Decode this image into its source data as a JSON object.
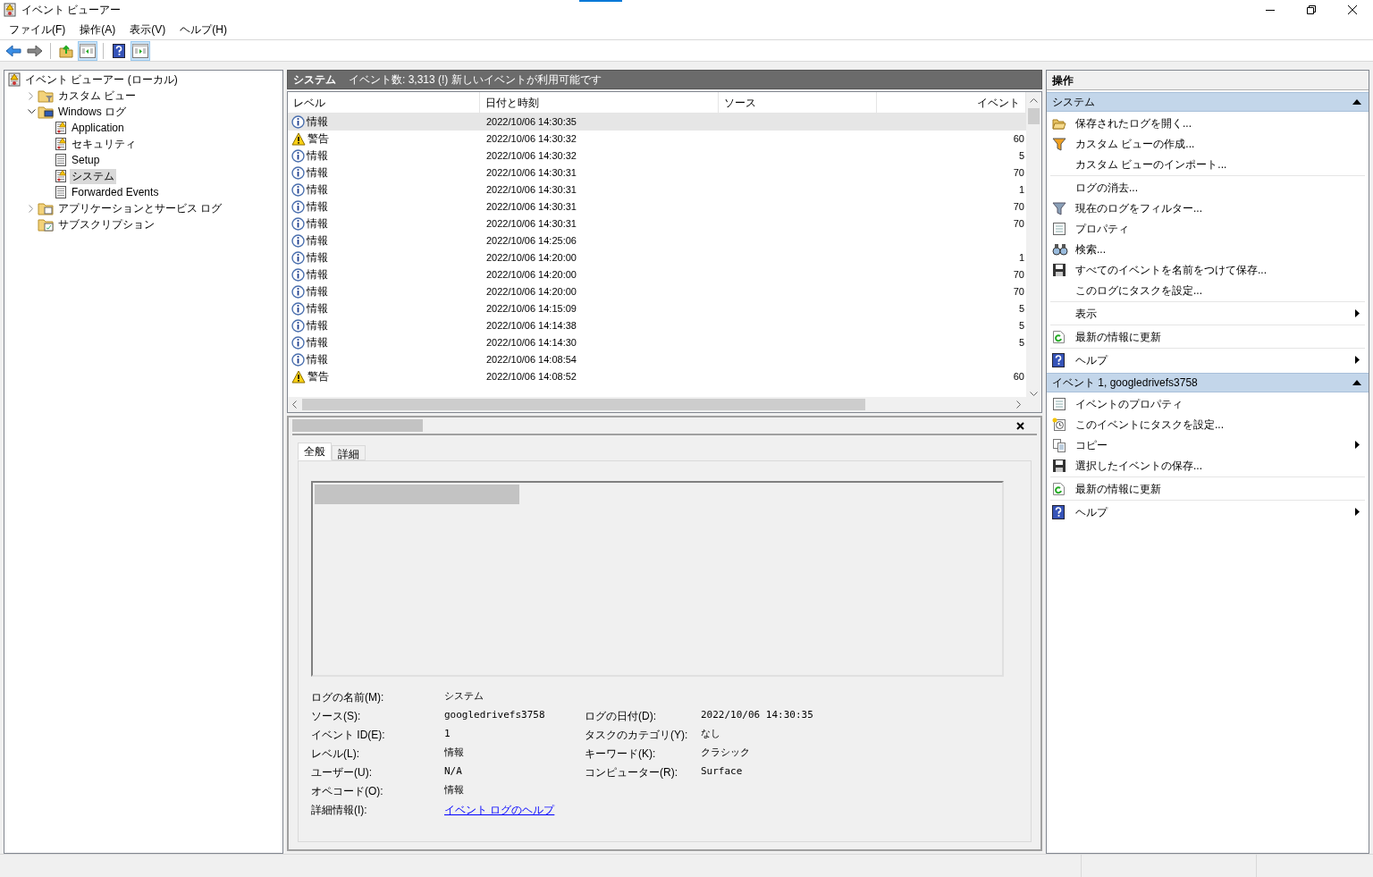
{
  "window": {
    "title": "イベント ビューアー"
  },
  "menu": [
    "ファイル(F)",
    "操作(A)",
    "表示(V)",
    "ヘルプ(H)"
  ],
  "toolbar": [
    {
      "kind": "back",
      "selected": false
    },
    {
      "kind": "forward",
      "selected": false
    },
    {
      "kind": "sep"
    },
    {
      "kind": "up",
      "selected": false
    },
    {
      "kind": "pane-left",
      "selected": true
    },
    {
      "kind": "sep"
    },
    {
      "kind": "help",
      "selected": false
    },
    {
      "kind": "pane-right",
      "selected": true
    }
  ],
  "tree": [
    {
      "label": "イベント ビューアー (ローカル)",
      "kind": "viewer",
      "selected": false,
      "children": [
        {
          "label": "カスタム ビュー",
          "kind": "filter-folder",
          "expanded": false,
          "selected": false
        },
        {
          "label": "Windows ログ",
          "kind": "pc-folder",
          "expanded": true,
          "selected": false,
          "children": [
            {
              "label": "Application",
              "kind": "log-warn",
              "selected": false
            },
            {
              "label": "セキュリティ",
              "kind": "log-warn",
              "selected": false
            },
            {
              "label": "Setup",
              "kind": "log",
              "selected": false
            },
            {
              "label": "システム",
              "kind": "log-warn",
              "selected": true
            },
            {
              "label": "Forwarded Events",
              "kind": "log",
              "selected": false
            }
          ]
        },
        {
          "label": "アプリケーションとサービス ログ",
          "kind": "folder",
          "expanded": false,
          "selected": false
        },
        {
          "label": "サブスクリプション",
          "kind": "sub-folder",
          "selected": false
        }
      ]
    }
  ],
  "log_header": {
    "name": "システム",
    "info": "イベント数: 3,313 (!) 新しいイベントが利用可能です"
  },
  "table": {
    "columns": [
      "レベル",
      "日付と時刻",
      "ソース",
      "イベント"
    ],
    "rows": [
      {
        "kind": "info",
        "level": "情報",
        "date": "2022/10/06 14:30:35",
        "event": "",
        "selected": true
      },
      {
        "kind": "warning",
        "level": "警告",
        "date": "2022/10/06 14:30:32",
        "event": "60",
        "selected": false
      },
      {
        "kind": "info",
        "level": "情報",
        "date": "2022/10/06 14:30:32",
        "event": "5",
        "selected": false
      },
      {
        "kind": "info",
        "level": "情報",
        "date": "2022/10/06 14:30:31",
        "event": "70",
        "selected": false
      },
      {
        "kind": "info",
        "level": "情報",
        "date": "2022/10/06 14:30:31",
        "event": "1",
        "selected": false
      },
      {
        "kind": "info",
        "level": "情報",
        "date": "2022/10/06 14:30:31",
        "event": "70",
        "selected": false
      },
      {
        "kind": "info",
        "level": "情報",
        "date": "2022/10/06 14:30:31",
        "event": "70",
        "selected": false
      },
      {
        "kind": "info",
        "level": "情報",
        "date": "2022/10/06 14:25:06",
        "event": "",
        "selected": false
      },
      {
        "kind": "info",
        "level": "情報",
        "date": "2022/10/06 14:20:00",
        "event": "1",
        "selected": false
      },
      {
        "kind": "info",
        "level": "情報",
        "date": "2022/10/06 14:20:00",
        "event": "70",
        "selected": false
      },
      {
        "kind": "info",
        "level": "情報",
        "date": "2022/10/06 14:20:00",
        "event": "70",
        "selected": false
      },
      {
        "kind": "info",
        "level": "情報",
        "date": "2022/10/06 14:15:09",
        "event": "5",
        "selected": false
      },
      {
        "kind": "info",
        "level": "情報",
        "date": "2022/10/06 14:14:38",
        "event": "5",
        "selected": false
      },
      {
        "kind": "info",
        "level": "情報",
        "date": "2022/10/06 14:14:30",
        "event": "5",
        "selected": false
      },
      {
        "kind": "info",
        "level": "情報",
        "date": "2022/10/06 14:08:54",
        "event": "",
        "selected": false
      },
      {
        "kind": "warning",
        "level": "警告",
        "date": "2022/10/06 14:08:52",
        "event": "60",
        "selected": false
      }
    ]
  },
  "detail": {
    "tabs": [
      {
        "label": "全般",
        "selected": true
      },
      {
        "label": "詳細",
        "selected": false
      }
    ],
    "fields_left": [
      {
        "label": "ログの名前(M):",
        "value": "システム"
      },
      {
        "label": "ソース(S):",
        "value": "googledrivefs3758"
      },
      {
        "label": "イベント ID(E):",
        "value": "1"
      },
      {
        "label": "レベル(L):",
        "value": "情報"
      },
      {
        "label": "ユーザー(U):",
        "value": "N/A"
      },
      {
        "label": "オペコード(O):",
        "value": "情報"
      },
      {
        "label": "詳細情報(I):",
        "value": "イベント ログのヘルプ",
        "kind": "link"
      }
    ],
    "fields_right": [
      {
        "label": "ログの日付(D):",
        "value": "2022/10/06 14:30:35"
      },
      {
        "label": "タスクのカテゴリ(Y):",
        "value": "なし"
      },
      {
        "label": "キーワード(K):",
        "value": "クラシック"
      },
      {
        "label": "コンピューター(R):",
        "value": "Surface"
      }
    ]
  },
  "actions": {
    "title": "操作",
    "sections": [
      {
        "title": "システム",
        "expanded": true,
        "groups": [
          [
            {
              "label": "保存されたログを開く...",
              "kind": "open",
              "submenu": false
            },
            {
              "label": "カスタム ビューの作成...",
              "kind": "filter-color",
              "submenu": false
            },
            {
              "label": "カスタム ビューのインポート...",
              "kind": "none",
              "submenu": false
            }
          ],
          [
            {
              "label": "ログの消去...",
              "kind": "none",
              "submenu": false
            },
            {
              "label": "現在のログをフィルター...",
              "kind": "filter",
              "submenu": false
            },
            {
              "label": "プロパティ",
              "kind": "properties",
              "submenu": false
            },
            {
              "label": "検索...",
              "kind": "find",
              "submenu": false
            },
            {
              "label": "すべてのイベントを名前をつけて保存...",
              "kind": "save",
              "submenu": false
            },
            {
              "label": "このログにタスクを設定...",
              "kind": "none",
              "submenu": false
            }
          ],
          [
            {
              "label": "表示",
              "kind": "none",
              "submenu": true
            }
          ],
          [
            {
              "label": "最新の情報に更新",
              "kind": "refresh",
              "submenu": false
            }
          ],
          [
            {
              "label": "ヘルプ",
              "kind": "help",
              "submenu": true
            }
          ]
        ]
      },
      {
        "title": "イベント 1, googledrivefs3758",
        "expanded": true,
        "groups": [
          [
            {
              "label": "イベントのプロパティ",
              "kind": "properties",
              "submenu": false
            },
            {
              "label": "このイベントにタスクを設定...",
              "kind": "task",
              "submenu": false
            },
            {
              "label": "コピー",
              "kind": "copy",
              "submenu": true
            },
            {
              "label": "選択したイベントの保存...",
              "kind": "save",
              "submenu": false
            }
          ],
          [
            {
              "label": "最新の情報に更新",
              "kind": "refresh",
              "submenu": false
            }
          ],
          [
            {
              "label": "ヘルプ",
              "kind": "help",
              "submenu": true
            }
          ]
        ]
      }
    ]
  }
}
